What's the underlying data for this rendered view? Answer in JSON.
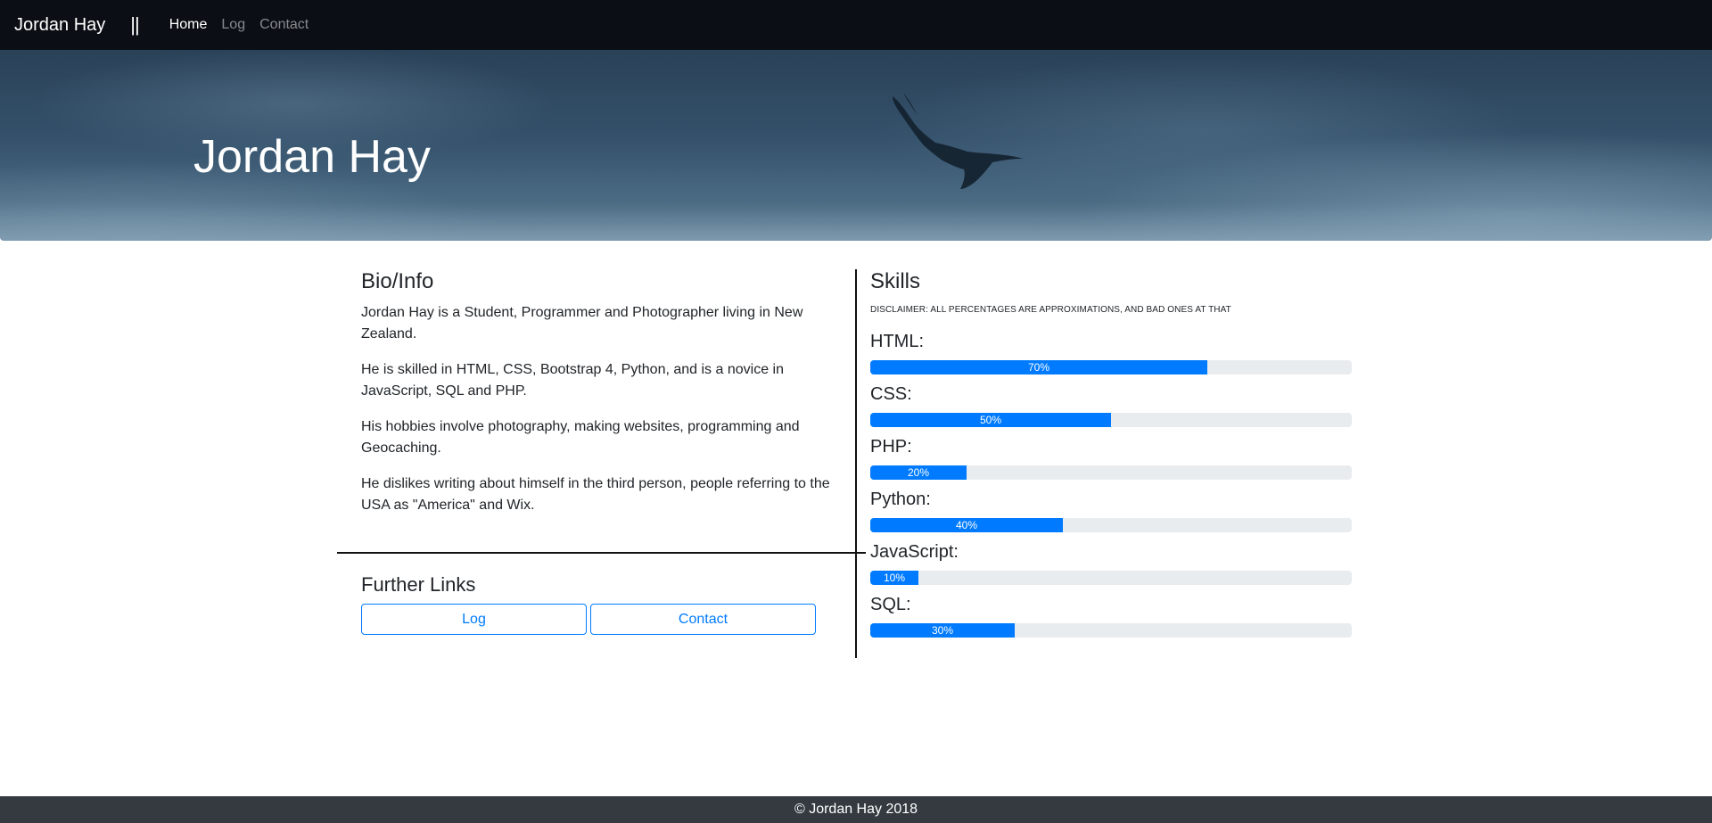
{
  "nav": {
    "brand": "Jordan Hay",
    "separator": "||",
    "links": [
      {
        "label": "Home",
        "active": true
      },
      {
        "label": "Log",
        "active": false
      },
      {
        "label": "Contact",
        "active": false
      }
    ]
  },
  "hero": {
    "title": "Jordan Hay"
  },
  "bio": {
    "heading": "Bio/Info",
    "paragraphs": [
      "Jordan Hay is a Student, Programmer and Photographer living in New Zealand.",
      "He is skilled in HTML, CSS, Bootstrap 4, Python, and is a novice in JavaScript, SQL and PHP.",
      "His hobbies involve photography, making websites, programming and Geocaching.",
      "He dislikes writing about himself in the third person, people referring to the USA as \"America\" and Wix."
    ]
  },
  "further_links": {
    "heading": "Further Links",
    "buttons": [
      "Log",
      "Contact"
    ]
  },
  "skills": {
    "heading": "Skills",
    "disclaimer": "DISCLAIMER: ALL PERCENTAGES ARE APPROXIMATIONS, AND BAD ONES AT THAT",
    "items": [
      {
        "label": "HTML:",
        "percent": 70,
        "text": "70%"
      },
      {
        "label": "CSS:",
        "percent": 50,
        "text": "50%"
      },
      {
        "label": "PHP:",
        "percent": 20,
        "text": "20%"
      },
      {
        "label": "Python:",
        "percent": 40,
        "text": "40%"
      },
      {
        "label": "JavaScript:",
        "percent": 10,
        "text": "10%"
      },
      {
        "label": "SQL:",
        "percent": 30,
        "text": "30%"
      }
    ]
  },
  "footer": {
    "text": "© Jordan Hay 2018"
  },
  "colors": {
    "accent": "#007bff",
    "navbar": "#0b0f15",
    "footer": "#343a40",
    "bar_track": "#e9ecef"
  }
}
